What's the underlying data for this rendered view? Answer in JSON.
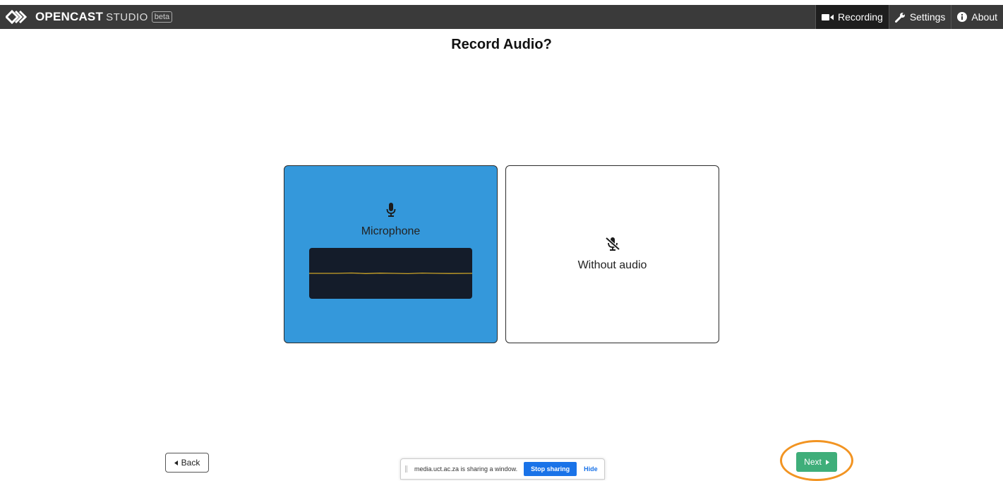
{
  "header": {
    "brand_name": "OPENCAST",
    "brand_sub": "STUDIO",
    "brand_badge": "beta",
    "nav": [
      {
        "label": "Recording",
        "icon": "video-camera-icon",
        "active": true
      },
      {
        "label": "Settings",
        "icon": "wrench-icon",
        "active": false
      },
      {
        "label": "About",
        "icon": "info-circle-icon",
        "active": false
      }
    ]
  },
  "main": {
    "title": "Record Audio?",
    "options": [
      {
        "label": "Microphone",
        "icon": "microphone-icon",
        "selected": true
      },
      {
        "label": "Without audio",
        "icon": "microphone-slash-icon",
        "selected": false
      }
    ]
  },
  "footer": {
    "back_label": "Back",
    "next_label": "Next"
  },
  "share_bar": {
    "message": "media.uct.ac.za is sharing a window.",
    "stop_label": "Stop sharing",
    "hide_label": "Hide"
  },
  "colors": {
    "header_bg": "#3a3a3a",
    "selected_card": "#3498db",
    "next_button": "#3fae7a",
    "highlight_ring": "#f29422",
    "meter_bg": "#141c2a",
    "meter_line": "#c9a227"
  }
}
